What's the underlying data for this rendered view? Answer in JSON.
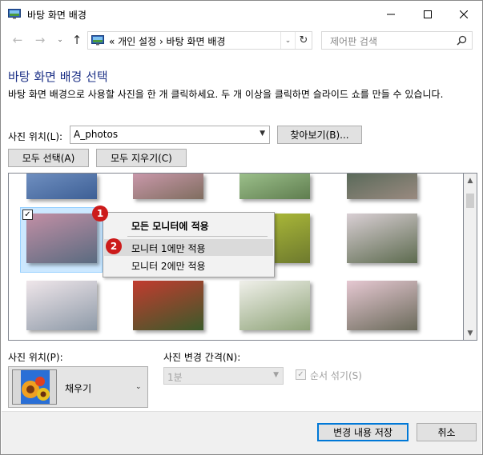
{
  "window": {
    "title": "바탕 화면 배경",
    "controls": {
      "minimize": "—",
      "maximize": "☐",
      "close": "✕"
    }
  },
  "nav": {
    "back": "←",
    "forward": "→",
    "recent": "⌄",
    "up": "↑",
    "address": "« 개인 설정 › 바탕 화면 배경",
    "address_dropdown": "⌄",
    "refresh": "↻",
    "search_placeholder": "제어판 검색"
  },
  "page": {
    "heading": "바탕 화면 배경 선택",
    "description": "바탕 화면 배경으로 사용할 사진을 한 개 클릭하세요. 두 개 이상을 클릭하면 슬라이드 쇼를 만들 수 있습니다."
  },
  "location": {
    "label": "사진 위치(L):",
    "value": "A_photos",
    "browse_button": "찾아보기(B)..."
  },
  "selection": {
    "select_all": "모두 선택(A)",
    "clear_all": "모두 지우기(C)"
  },
  "gallery": {
    "selected_checkbox": "✓",
    "thumbnails": [
      {
        "name": "blue-tree",
        "colors": [
          "#6f8fc0",
          "#3d5f95"
        ]
      },
      {
        "name": "magnolia-top",
        "colors": [
          "#c998aa",
          "#7f6d5f"
        ]
      },
      {
        "name": "green-branch",
        "colors": [
          "#9bbf8a",
          "#5f7d4f"
        ]
      },
      {
        "name": "dark-trees",
        "colors": [
          "#5a6a5a",
          "#9a8a80"
        ]
      },
      {
        "name": "magnolia-building",
        "colors": [
          "#c28fa5",
          "#5a6b80"
        ]
      },
      {
        "name": "cherry-blossom-tree",
        "colors": [
          "#e8dce4",
          "#6a7a5a"
        ]
      },
      {
        "name": "yellow-green-field",
        "colors": [
          "#b4c23a",
          "#6e7a2e"
        ]
      },
      {
        "name": "white-cherry-park",
        "colors": [
          "#d9cfd4",
          "#5d6b4f"
        ]
      },
      {
        "name": "cherry-blossom-sky",
        "colors": [
          "#efe6ea",
          "#8e9aa8"
        ]
      },
      {
        "name": "red-berries",
        "colors": [
          "#c23b2f",
          "#3b5a2a"
        ]
      },
      {
        "name": "white-flowers",
        "colors": [
          "#f0f0ea",
          "#8ea378"
        ]
      },
      {
        "name": "pink-cherry-tree",
        "colors": [
          "#e6c8d2",
          "#6a6a5a"
        ]
      }
    ]
  },
  "context_menu": {
    "header": "모든 모니터에 적용",
    "items": [
      "모니터 1에만 적용",
      "모니터 2에만 적용"
    ],
    "badges": [
      "1",
      "2"
    ],
    "highlighted_index": 0
  },
  "picture_position": {
    "label": "사진 위치(P):",
    "value": "채우기"
  },
  "interval": {
    "label": "사진 변경 간격(N):",
    "value": "1분"
  },
  "shuffle": {
    "label": "순서 섞기(S)",
    "checked": "✓"
  },
  "footer": {
    "save": "변경 내용 저장",
    "cancel": "취소"
  },
  "colors": {
    "heading": "#1e3287",
    "badge": "#cc1b1b",
    "selection": "#cce8ff"
  }
}
